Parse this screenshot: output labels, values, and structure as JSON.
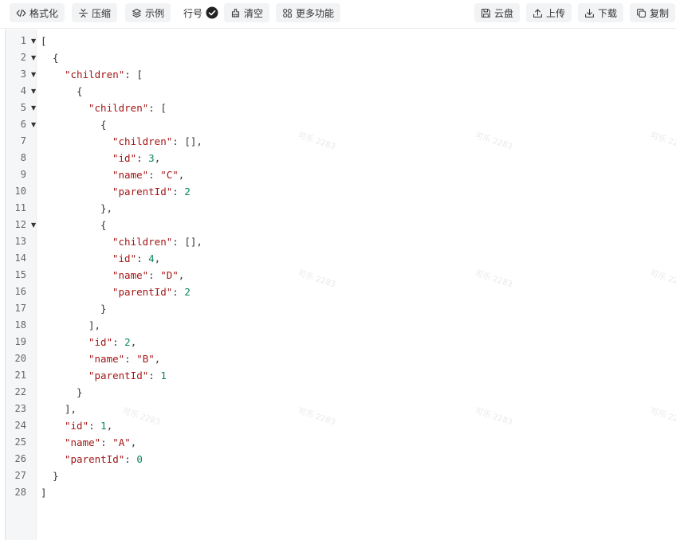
{
  "toolbar": {
    "format": "格式化",
    "compress": "压缩",
    "example": "示例",
    "line_numbers": "行号",
    "clear": "清空",
    "more": "更多功能",
    "cloud": "云盘",
    "upload": "上传",
    "download": "下载",
    "copy": "复制"
  },
  "watermark": "可乐 2283",
  "lines": [
    {
      "n": "1",
      "fold": true,
      "indent": 0,
      "tokens": [
        [
          "p",
          "["
        ]
      ]
    },
    {
      "n": "2",
      "fold": true,
      "indent": 1,
      "tokens": [
        [
          "p",
          "{"
        ]
      ]
    },
    {
      "n": "3",
      "fold": true,
      "indent": 2,
      "tokens": [
        [
          "k",
          "\"children\""
        ],
        [
          "p",
          ": ["
        ]
      ]
    },
    {
      "n": "4",
      "fold": true,
      "indent": 3,
      "tokens": [
        [
          "p",
          "{"
        ]
      ]
    },
    {
      "n": "5",
      "fold": true,
      "indent": 4,
      "tokens": [
        [
          "k",
          "\"children\""
        ],
        [
          "p",
          ": ["
        ]
      ]
    },
    {
      "n": "6",
      "fold": true,
      "indent": 5,
      "tokens": [
        [
          "p",
          "{"
        ]
      ]
    },
    {
      "n": "7",
      "fold": false,
      "indent": 6,
      "tokens": [
        [
          "k",
          "\"children\""
        ],
        [
          "p",
          ": [],"
        ]
      ]
    },
    {
      "n": "8",
      "fold": false,
      "indent": 6,
      "tokens": [
        [
          "k",
          "\"id\""
        ],
        [
          "p",
          ": "
        ],
        [
          "n",
          "3"
        ],
        [
          "p",
          ","
        ]
      ]
    },
    {
      "n": "9",
      "fold": false,
      "indent": 6,
      "tokens": [
        [
          "k",
          "\"name\""
        ],
        [
          "p",
          ": "
        ],
        [
          "s",
          "\"C\""
        ],
        [
          "p",
          ","
        ]
      ]
    },
    {
      "n": "10",
      "fold": false,
      "indent": 6,
      "tokens": [
        [
          "k",
          "\"parentId\""
        ],
        [
          "p",
          ": "
        ],
        [
          "n",
          "2"
        ]
      ]
    },
    {
      "n": "11",
      "fold": false,
      "indent": 5,
      "tokens": [
        [
          "p",
          "},"
        ]
      ]
    },
    {
      "n": "12",
      "fold": true,
      "indent": 5,
      "tokens": [
        [
          "p",
          "{"
        ]
      ]
    },
    {
      "n": "13",
      "fold": false,
      "indent": 6,
      "tokens": [
        [
          "k",
          "\"children\""
        ],
        [
          "p",
          ": [],"
        ]
      ]
    },
    {
      "n": "14",
      "fold": false,
      "indent": 6,
      "tokens": [
        [
          "k",
          "\"id\""
        ],
        [
          "p",
          ": "
        ],
        [
          "n",
          "4"
        ],
        [
          "p",
          ","
        ]
      ]
    },
    {
      "n": "15",
      "fold": false,
      "indent": 6,
      "tokens": [
        [
          "k",
          "\"name\""
        ],
        [
          "p",
          ": "
        ],
        [
          "s",
          "\"D\""
        ],
        [
          "p",
          ","
        ]
      ]
    },
    {
      "n": "16",
      "fold": false,
      "indent": 6,
      "tokens": [
        [
          "k",
          "\"parentId\""
        ],
        [
          "p",
          ": "
        ],
        [
          "n",
          "2"
        ]
      ]
    },
    {
      "n": "17",
      "fold": false,
      "indent": 5,
      "tokens": [
        [
          "p",
          "}"
        ]
      ]
    },
    {
      "n": "18",
      "fold": false,
      "indent": 4,
      "tokens": [
        [
          "p",
          "],"
        ]
      ]
    },
    {
      "n": "19",
      "fold": false,
      "indent": 4,
      "tokens": [
        [
          "k",
          "\"id\""
        ],
        [
          "p",
          ": "
        ],
        [
          "n",
          "2"
        ],
        [
          "p",
          ","
        ]
      ]
    },
    {
      "n": "20",
      "fold": false,
      "indent": 4,
      "tokens": [
        [
          "k",
          "\"name\""
        ],
        [
          "p",
          ": "
        ],
        [
          "s",
          "\"B\""
        ],
        [
          "p",
          ","
        ]
      ]
    },
    {
      "n": "21",
      "fold": false,
      "indent": 4,
      "tokens": [
        [
          "k",
          "\"parentId\""
        ],
        [
          "p",
          ": "
        ],
        [
          "n",
          "1"
        ]
      ]
    },
    {
      "n": "22",
      "fold": false,
      "indent": 3,
      "tokens": [
        [
          "p",
          "}"
        ]
      ]
    },
    {
      "n": "23",
      "fold": false,
      "indent": 2,
      "tokens": [
        [
          "p",
          "],"
        ]
      ]
    },
    {
      "n": "24",
      "fold": false,
      "indent": 2,
      "tokens": [
        [
          "k",
          "\"id\""
        ],
        [
          "p",
          ": "
        ],
        [
          "n",
          "1"
        ],
        [
          "p",
          ","
        ]
      ]
    },
    {
      "n": "25",
      "fold": false,
      "indent": 2,
      "tokens": [
        [
          "k",
          "\"name\""
        ],
        [
          "p",
          ": "
        ],
        [
          "s",
          "\"A\""
        ],
        [
          "p",
          ","
        ]
      ]
    },
    {
      "n": "26",
      "fold": false,
      "indent": 2,
      "tokens": [
        [
          "k",
          "\"parentId\""
        ],
        [
          "p",
          ": "
        ],
        [
          "n",
          "0"
        ]
      ]
    },
    {
      "n": "27",
      "fold": false,
      "indent": 1,
      "tokens": [
        [
          "p",
          "}"
        ]
      ]
    },
    {
      "n": "28",
      "fold": false,
      "indent": 0,
      "tokens": [
        [
          "p",
          "]"
        ]
      ]
    }
  ]
}
